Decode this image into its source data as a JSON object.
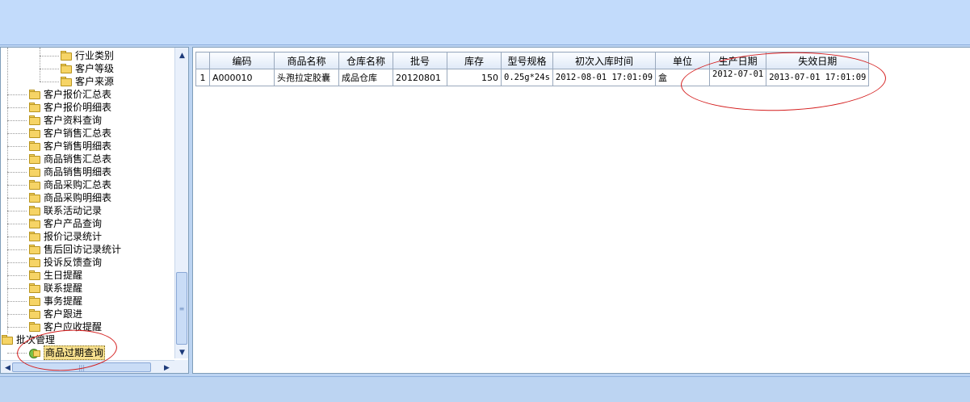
{
  "tree": {
    "items": [
      {
        "label": "行业类别",
        "level": 3
      },
      {
        "label": "客户等级",
        "level": 3
      },
      {
        "label": "客户来源",
        "level": 3
      },
      {
        "label": "客户报价汇总表",
        "level": 2
      },
      {
        "label": "客户报价明细表",
        "level": 2
      },
      {
        "label": "客户资料查询",
        "level": 2
      },
      {
        "label": "客户销售汇总表",
        "level": 2
      },
      {
        "label": "客户销售明细表",
        "level": 2
      },
      {
        "label": "商品销售汇总表",
        "level": 2
      },
      {
        "label": "商品销售明细表",
        "level": 2
      },
      {
        "label": "商品采购汇总表",
        "level": 2
      },
      {
        "label": "商品采购明细表",
        "level": 2
      },
      {
        "label": "联系活动记录",
        "level": 2
      },
      {
        "label": "客户产品查询",
        "level": 2
      },
      {
        "label": "报价记录统计",
        "level": 2
      },
      {
        "label": "售后回访记录统计",
        "level": 2
      },
      {
        "label": "投诉反馈查询",
        "level": 2
      },
      {
        "label": "生日提醒",
        "level": 2
      },
      {
        "label": "联系提醒",
        "level": 2
      },
      {
        "label": "事务提醒",
        "level": 2
      },
      {
        "label": "客户跟进",
        "level": 2
      },
      {
        "label": "客户应收提醒",
        "level": 2
      },
      {
        "label": "批次管理",
        "level": 1
      },
      {
        "label": "商品过期查询",
        "level": 2,
        "selected": true
      }
    ]
  },
  "grid": {
    "columns": [
      "编码",
      "商品名称",
      "仓库名称",
      "批号",
      "库存",
      "型号规格",
      "初次入库时间",
      "单位",
      "生产日期",
      "失效日期"
    ],
    "rows": [
      {
        "row_number": "1",
        "cells": [
          "A000010",
          "头孢拉定胶囊",
          "成品仓库",
          "20120801",
          "150",
          "0.25g*24s",
          "2012-08-01 17:01:09",
          "盒",
          "2012-07-01",
          "2013-07-01 17:01:09"
        ]
      }
    ]
  },
  "colors": {
    "frame_background": "#bcd4f2",
    "annotation_red": "#d41c1c",
    "selection_highlight": "#f7e08e"
  }
}
